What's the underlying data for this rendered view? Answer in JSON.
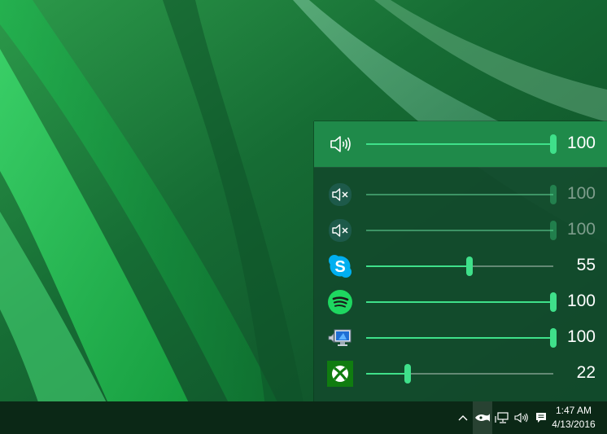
{
  "colors": {
    "accent": "#3fe08a",
    "flyout_bg": "#124a2c",
    "master_bg": "#1f8a4a",
    "taskbar_bg": "#0b2816"
  },
  "flyout": {
    "master": {
      "icon": "speaker-icon",
      "value": "100",
      "level": 1.0
    },
    "apps": [
      {
        "icon": "muted-speaker-icon",
        "value": "100",
        "level": 1.0,
        "dimmed": true
      },
      {
        "icon": "muted-speaker-icon",
        "value": "100",
        "level": 1.0,
        "dimmed": true
      },
      {
        "icon": "skype-icon",
        "value": "55",
        "level": 0.55,
        "dimmed": false
      },
      {
        "icon": "spotify-icon",
        "value": "100",
        "level": 1.0,
        "dimmed": false
      },
      {
        "icon": "system-sounds-icon",
        "value": "100",
        "level": 1.0,
        "dimmed": false
      },
      {
        "icon": "xbox-icon",
        "value": "22",
        "level": 0.22,
        "dimmed": false
      }
    ]
  },
  "taskbar": {
    "tray_icons": [
      "chevron-up-icon",
      "ear-trumpet-icon",
      "network-icon",
      "volume-icon",
      "action-center-icon"
    ],
    "clock": {
      "time": "1:47 AM",
      "date": "4/13/2016"
    }
  }
}
